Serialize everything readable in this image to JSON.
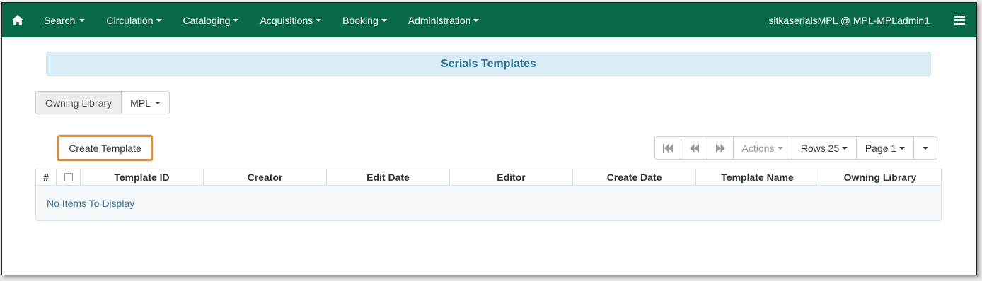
{
  "nav": {
    "items": [
      {
        "label": "Search"
      },
      {
        "label": "Circulation"
      },
      {
        "label": "Cataloging"
      },
      {
        "label": "Acquisitions"
      },
      {
        "label": "Booking"
      },
      {
        "label": "Administration"
      }
    ],
    "user": "sitkaserialsMPL @ MPL-MPLadmin1"
  },
  "page": {
    "title": "Serials Templates"
  },
  "filter": {
    "owning_label": "Owning Library",
    "owning_value": "MPL"
  },
  "actions": {
    "create_label": "Create Template"
  },
  "toolbar": {
    "actions_label": "Actions",
    "rows_label": "Rows 25",
    "page_label": "Page 1"
  },
  "grid": {
    "columns": [
      "#",
      "",
      "Template ID",
      "Creator",
      "Edit Date",
      "Editor",
      "Create Date",
      "Template Name",
      "Owning Library"
    ],
    "empty_message": "No Items To Display"
  },
  "colors": {
    "navbar": "#0a6a46",
    "title_bg": "#d9edf7",
    "title_text": "#31708f",
    "highlight": "#f08a24"
  }
}
